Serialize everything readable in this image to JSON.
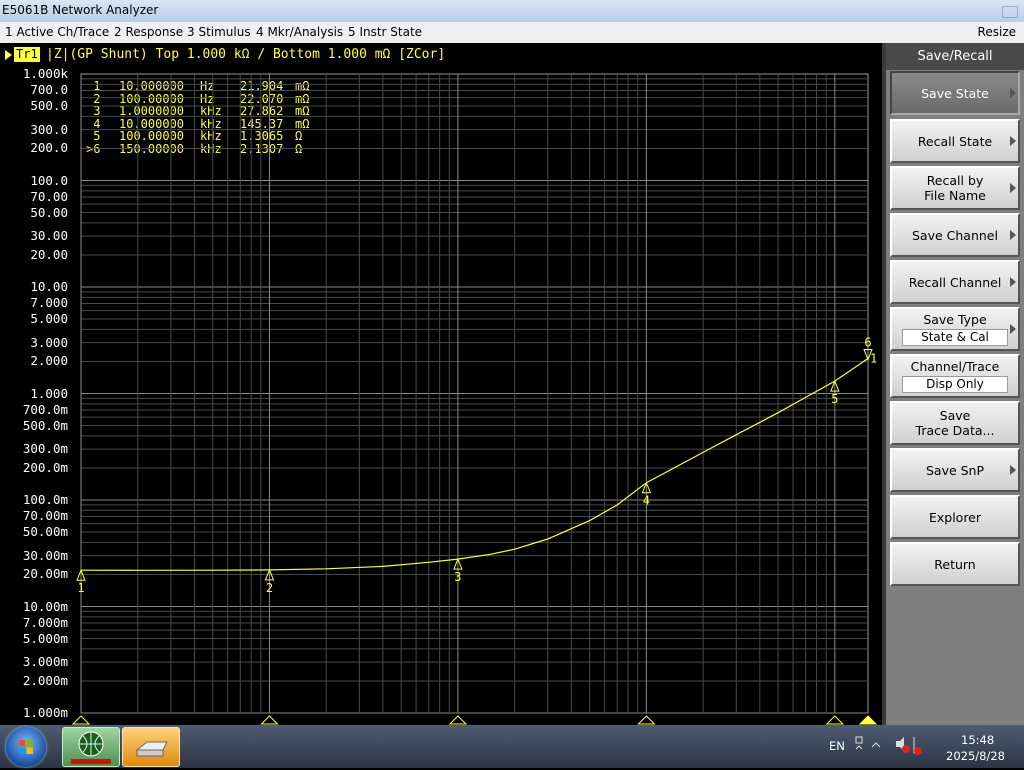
{
  "window": {
    "title": "E5061B Network Analyzer"
  },
  "menu": {
    "items": [
      "1 Active Ch/Trace",
      "2 Response",
      "3 Stimulus",
      "4 Mkr/Analysis",
      "5 Instr State"
    ],
    "resize_label": "Resize"
  },
  "trace_header": {
    "trace_id": "Tr1",
    "info": "|Z|(GP Shunt)  Top 1.000 kΩ / Bottom 1.000 mΩ [ZCor]"
  },
  "markers": [
    {
      "id": "1",
      "active": false,
      "freq": "10.000000",
      "unit": "Hz",
      "value": "21.904",
      "vunit": "mΩ"
    },
    {
      "id": "2",
      "active": false,
      "freq": "100.00000",
      "unit": "Hz",
      "value": "22.070",
      "vunit": "mΩ"
    },
    {
      "id": "3",
      "active": false,
      "freq": "1.0000000",
      "unit": "kHz",
      "value": "27.862",
      "vunit": "mΩ"
    },
    {
      "id": "4",
      "active": false,
      "freq": "10.000000",
      "unit": "kHz",
      "value": "145.37",
      "vunit": "mΩ"
    },
    {
      "id": "5",
      "active": false,
      "freq": "100.00000",
      "unit": "kHz",
      "value": "1.3065",
      "vunit": "Ω"
    },
    {
      "id": "6",
      "active": true,
      "freq": "150.00000",
      "unit": "kHz",
      "value": "2.1307",
      "vunit": "Ω"
    }
  ],
  "chart_data": {
    "type": "line",
    "x_scale": "log",
    "y_scale": "log",
    "xlim": [
      10,
      150000
    ],
    "ylim": [
      0.001,
      1000
    ],
    "y_ticks": [
      {
        "v": 1000,
        "label": "1.000k"
      },
      {
        "v": 700,
        "label": "700.0"
      },
      {
        "v": 500,
        "label": "500.0"
      },
      {
        "v": 300,
        "label": "300.0"
      },
      {
        "v": 200,
        "label": "200.0"
      },
      {
        "v": 100,
        "label": "100.0"
      },
      {
        "v": 70,
        "label": "70.00"
      },
      {
        "v": 50,
        "label": "50.00"
      },
      {
        "v": 30,
        "label": "30.00"
      },
      {
        "v": 20,
        "label": "20.00"
      },
      {
        "v": 10,
        "label": "10.00"
      },
      {
        "v": 7,
        "label": "7.000"
      },
      {
        "v": 5,
        "label": "5.000"
      },
      {
        "v": 3,
        "label": "3.000"
      },
      {
        "v": 2,
        "label": "2.000"
      },
      {
        "v": 1,
        "label": "1.000"
      },
      {
        "v": 0.7,
        "label": "700.0m"
      },
      {
        "v": 0.5,
        "label": "500.0m"
      },
      {
        "v": 0.3,
        "label": "300.0m"
      },
      {
        "v": 0.2,
        "label": "200.0m"
      },
      {
        "v": 0.1,
        "label": "100.0m"
      },
      {
        "v": 0.07,
        "label": "70.00m"
      },
      {
        "v": 0.05,
        "label": "50.00m"
      },
      {
        "v": 0.03,
        "label": "30.00m"
      },
      {
        "v": 0.02,
        "label": "20.00m"
      },
      {
        "v": 0.01,
        "label": "10.00m"
      },
      {
        "v": 0.007,
        "label": "7.000m"
      },
      {
        "v": 0.005,
        "label": "5.000m"
      },
      {
        "v": 0.003,
        "label": "3.000m"
      },
      {
        "v": 0.002,
        "label": "2.000m"
      },
      {
        "v": 0.001,
        "label": "1.000m"
      }
    ],
    "series": [
      {
        "x": [
          10,
          20,
          50,
          100,
          200,
          400,
          700,
          1000,
          1500,
          2000,
          3000,
          5000,
          7000,
          10000,
          20000,
          30000,
          50000,
          70000,
          100000,
          150000
        ],
        "y": [
          0.0219,
          0.02185,
          0.0219,
          0.02207,
          0.0226,
          0.0238,
          0.026,
          0.02786,
          0.031,
          0.0345,
          0.043,
          0.064,
          0.09,
          0.14537,
          0.28,
          0.41,
          0.66,
          0.92,
          1.3065,
          2.1307
        ]
      }
    ],
    "marker_points": [
      {
        "id": "1",
        "x": 10,
        "y": 0.021904
      },
      {
        "id": "2",
        "x": 100,
        "y": 0.02207
      },
      {
        "id": "3",
        "x": 1000,
        "y": 0.027862
      },
      {
        "id": "4",
        "x": 10000,
        "y": 0.14537
      },
      {
        "id": "5",
        "x": 100000,
        "y": 1.3065
      },
      {
        "id": "6",
        "x": 150000,
        "y": 2.1307
      }
    ],
    "ref_label": "1",
    "trace_color": "#ffff40",
    "grid_color": "#7a7a7a"
  },
  "sidebar": {
    "title": "Save/Recall",
    "buttons": [
      {
        "id": "save-state",
        "label": "Save State",
        "active": true,
        "arrow": true
      },
      {
        "id": "recall-state",
        "label": "Recall State",
        "active": false,
        "arrow": true
      },
      {
        "id": "recall-by-file-name",
        "label": "Recall by\nFile Name",
        "active": false,
        "arrow": true
      },
      {
        "id": "save-channel",
        "label": "Save Channel",
        "active": false,
        "arrow": true
      },
      {
        "id": "recall-channel",
        "label": "Recall Channel",
        "active": false,
        "arrow": true
      },
      {
        "id": "save-type",
        "label": "Save Type",
        "value": "State & Cal",
        "active": false,
        "arrow": true
      },
      {
        "id": "channel-trace",
        "label": "Channel/Trace",
        "value": "Disp Only",
        "active": false,
        "arrow": false
      },
      {
        "id": "save-trace-data",
        "label": "Save\nTrace Data...",
        "active": false,
        "arrow": false
      },
      {
        "id": "save-snp",
        "label": "Save SnP",
        "active": false,
        "arrow": true
      },
      {
        "id": "explorer",
        "label": "Explorer",
        "active": false,
        "arrow": false
      },
      {
        "id": "return",
        "label": "Return",
        "active": false,
        "arrow": false
      }
    ]
  },
  "taskbar": {
    "lang": "EN",
    "time": "15:48",
    "date": "2025/8/28"
  }
}
